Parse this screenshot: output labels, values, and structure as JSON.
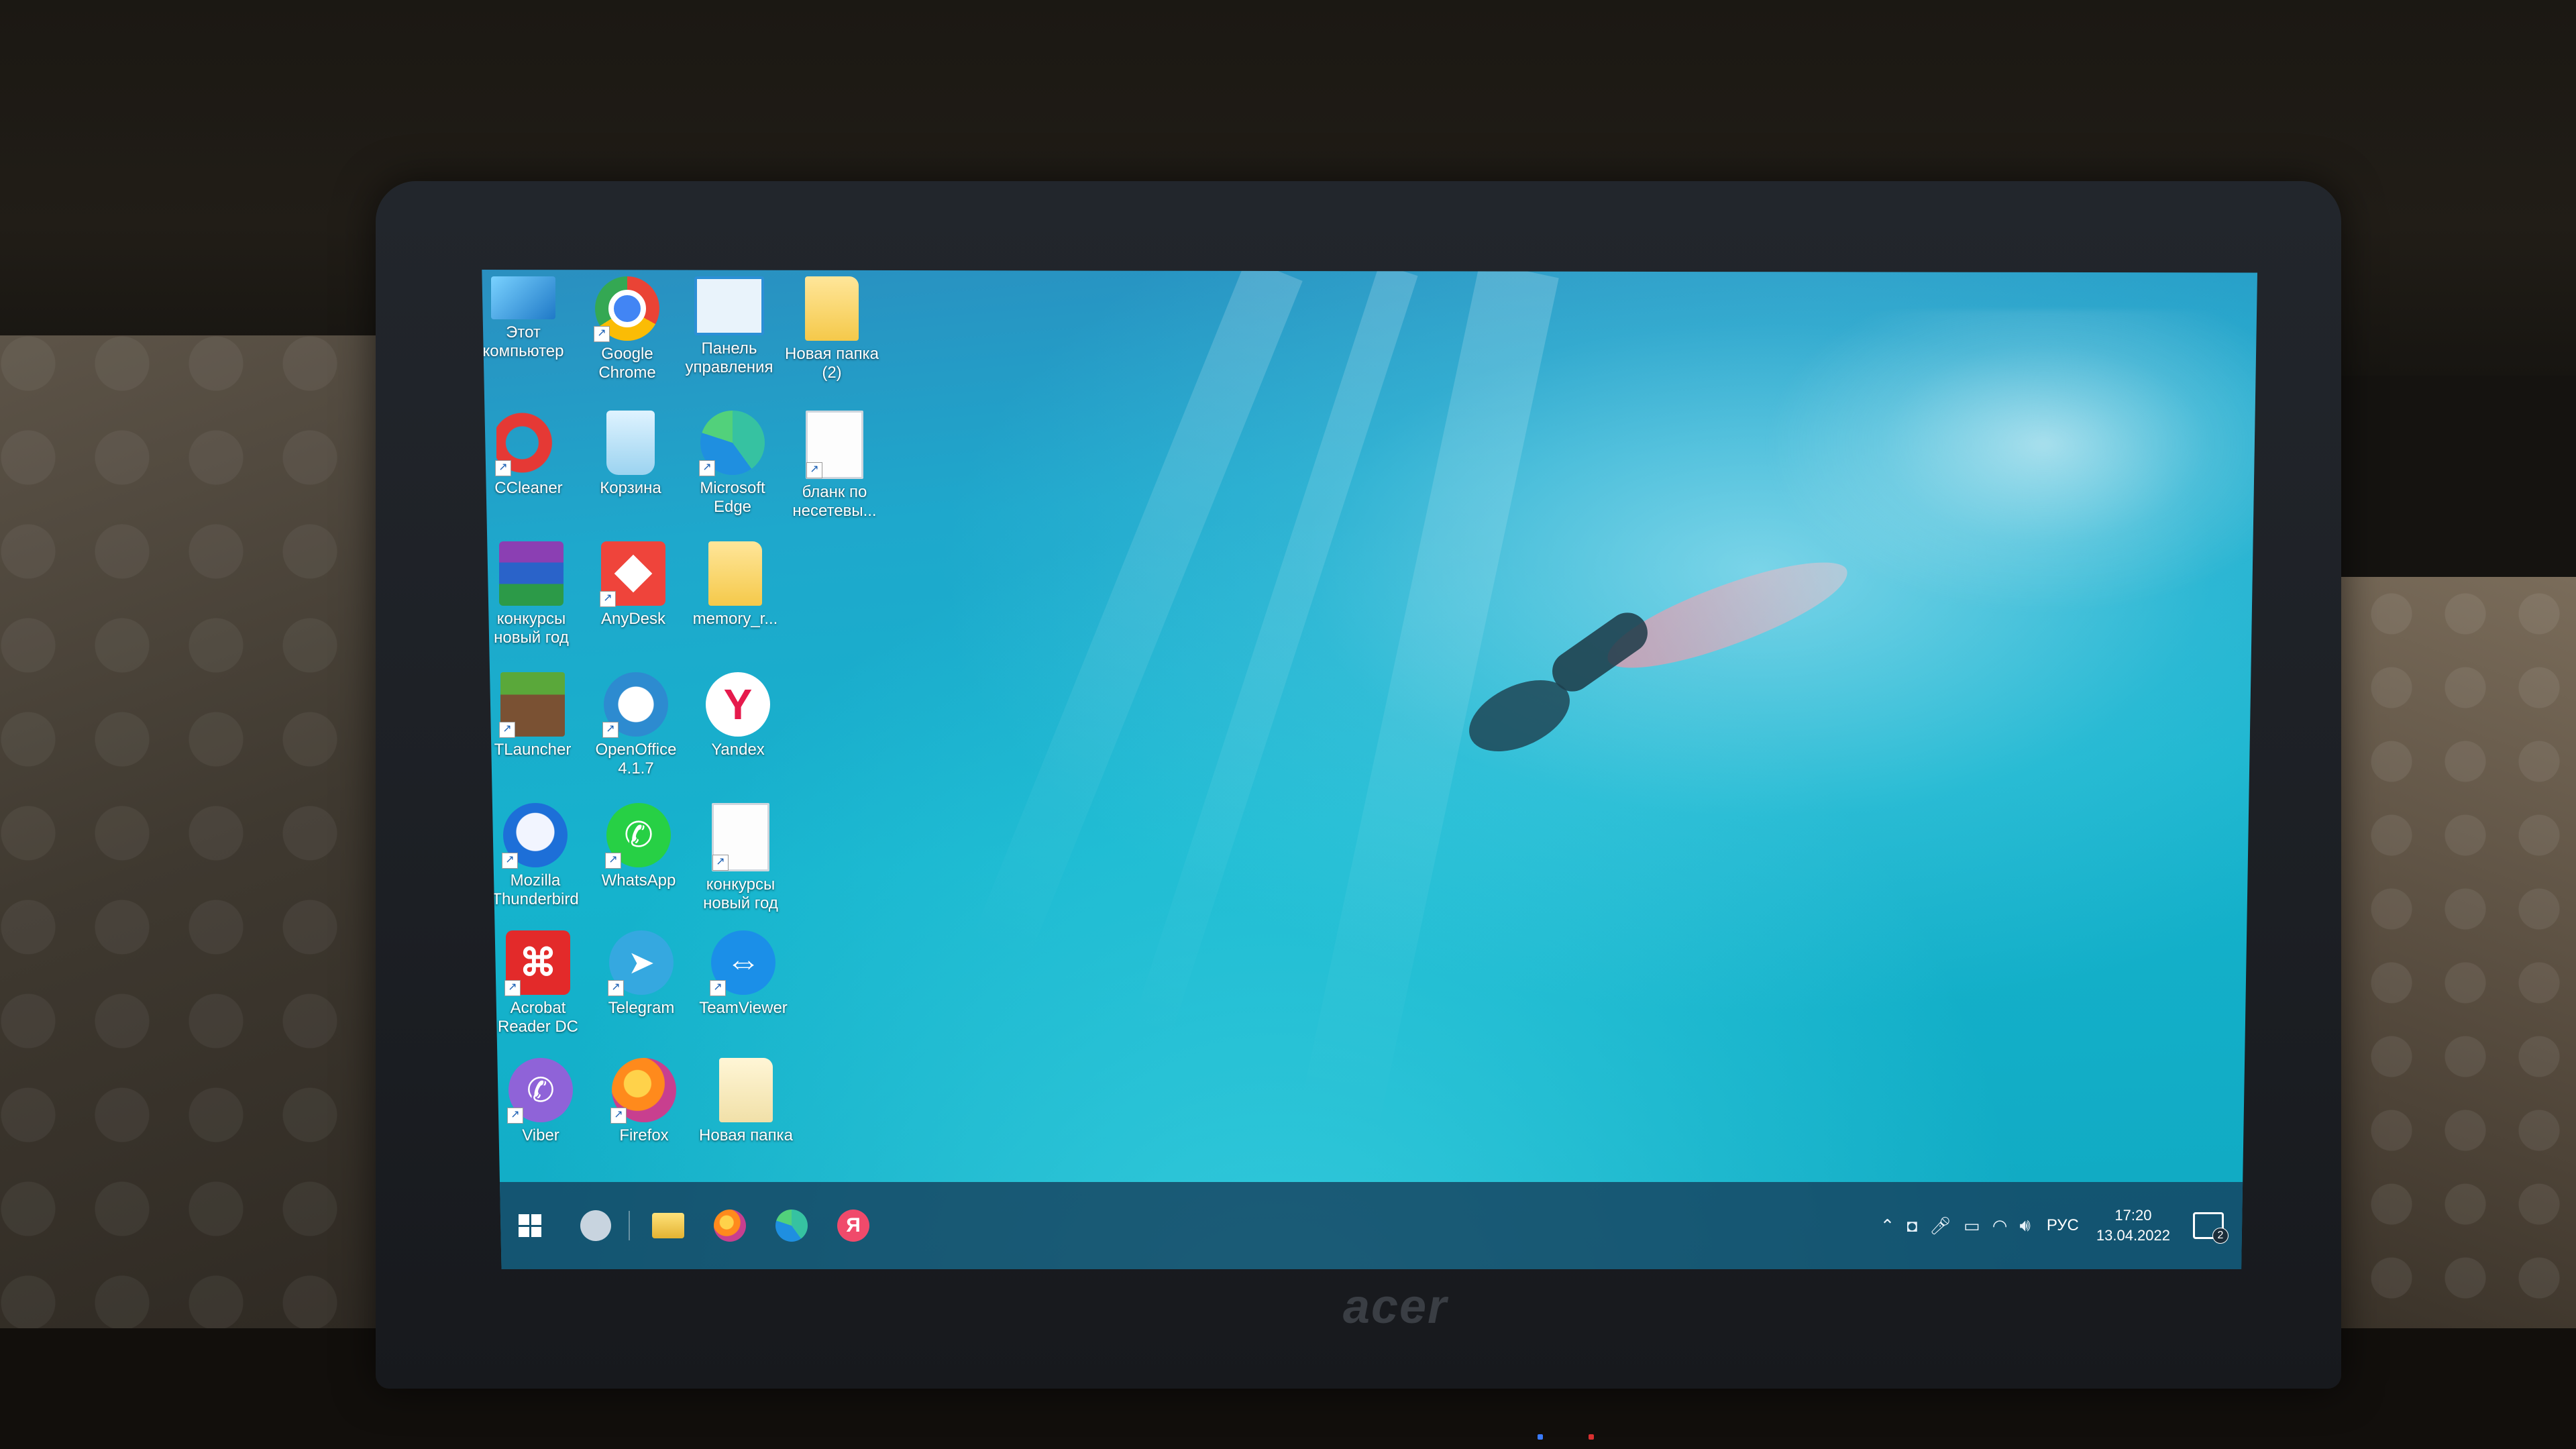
{
  "desktop": {
    "icons": [
      {
        "label": "Этот\nкомпьютер"
      },
      {
        "label": "Google\nChrome"
      },
      {
        "label": "Панель\nуправления"
      },
      {
        "label": "Новая папка\n(2)"
      },
      {
        "label": "CCleaner"
      },
      {
        "label": "Корзина"
      },
      {
        "label": "Microsoft\nEdge"
      },
      {
        "label": "бланк по\nнесетевы..."
      },
      {
        "label": "конкурсы\nновый год"
      },
      {
        "label": "AnyDesk"
      },
      {
        "label": "memory_r..."
      },
      {
        "label": "TLauncher"
      },
      {
        "label": "OpenOffice\n4.1.7"
      },
      {
        "label": "Yandex"
      },
      {
        "label": "Mozilla\nThunderbird"
      },
      {
        "label": "WhatsApp"
      },
      {
        "label": "конкурсы\nновый год"
      },
      {
        "label": "Acrobat\nReader DC"
      },
      {
        "label": "Telegram"
      },
      {
        "label": "TeamViewer"
      },
      {
        "label": "Viber"
      },
      {
        "label": "Firefox"
      },
      {
        "label": "Новая папка"
      }
    ]
  },
  "taskbar": {
    "yandex_glyph": "Я",
    "tray": {
      "language": "РУС",
      "time": "17:20",
      "date": "13.04.2022",
      "notification_count": "2"
    }
  },
  "device": {
    "brand": "acer"
  },
  "colors": {
    "taskbar": "#143c5a",
    "wallpaper_water": "#15b3cd"
  }
}
